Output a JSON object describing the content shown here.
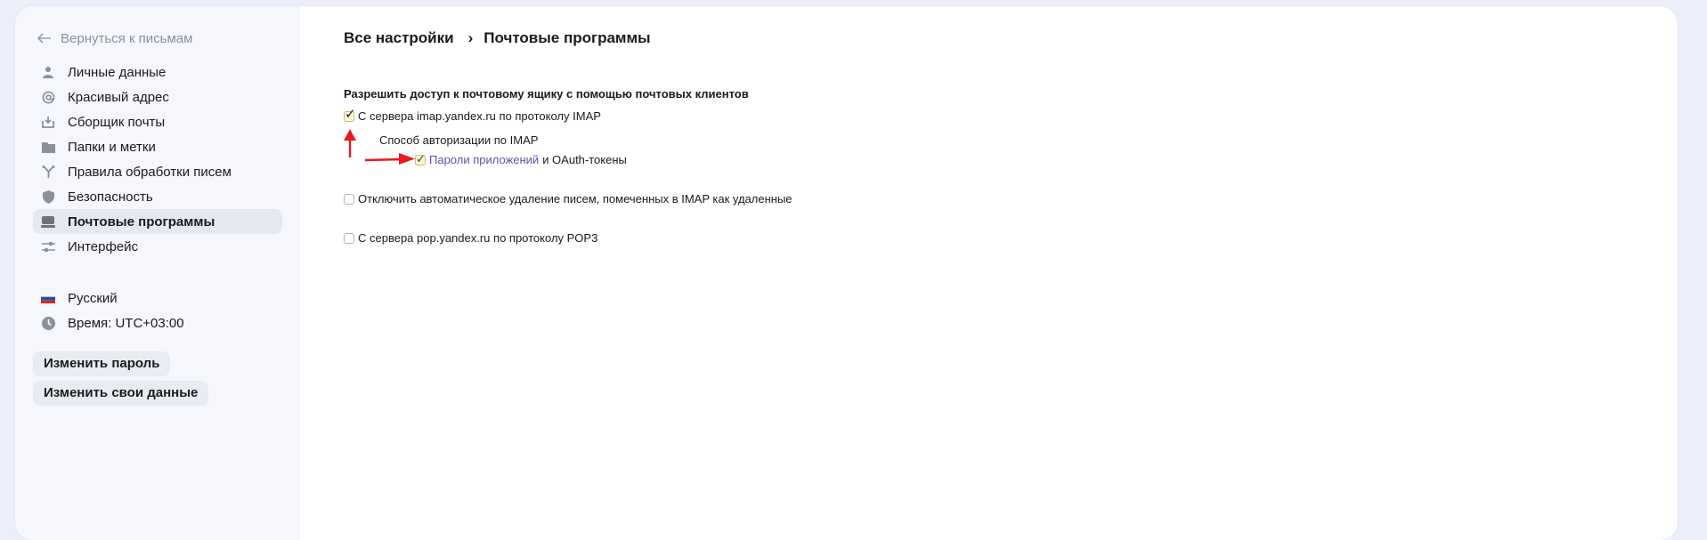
{
  "sidebar": {
    "back_label": "Вернуться к письмам",
    "items": [
      {
        "label": "Личные данные",
        "icon": "person-icon"
      },
      {
        "label": "Красивый адрес",
        "icon": "at-icon"
      },
      {
        "label": "Сборщик почты",
        "icon": "inbox-download-icon"
      },
      {
        "label": "Папки и метки",
        "icon": "folder-icon"
      },
      {
        "label": "Правила обработки писем",
        "icon": "branch-icon"
      },
      {
        "label": "Безопасность",
        "icon": "shield-icon"
      },
      {
        "label": "Почтовые программы",
        "icon": "mail-client-icon",
        "active": true
      },
      {
        "label": "Интерфейс",
        "icon": "sliders-icon"
      }
    ],
    "language": "Русский",
    "time": "Время: UTC+03:00",
    "change_password": "Изменить пароль",
    "change_data": "Изменить свои данные"
  },
  "breadcrumb": {
    "root": "Все настройки",
    "separator": "›",
    "current": "Почтовые программы"
  },
  "settings": {
    "section_title": "Разрешить доступ к почтовому ящику с помощью почтовых клиентов",
    "imap": {
      "label": "С сервера imap.yandex.ru по протоколу IMAP",
      "checked": true
    },
    "imap_auth_title": "Способ авторизации по IMAP",
    "app_passwords": {
      "link": "Пароли приложений",
      "suffix": "и OAuth-токены",
      "checked": true
    },
    "disable_autodelete": {
      "label": "Отключить автоматическое удаление писем, помеченных в IMAP как удаленные",
      "checked": false
    },
    "pop3": {
      "label": "С сервера pop.yandex.ru по протоколу POP3",
      "checked": false
    }
  },
  "colors": {
    "accent_link": "#5456a8",
    "annotation_arrow": "#e8191f",
    "active_item_bg": "#e6e8f1"
  }
}
